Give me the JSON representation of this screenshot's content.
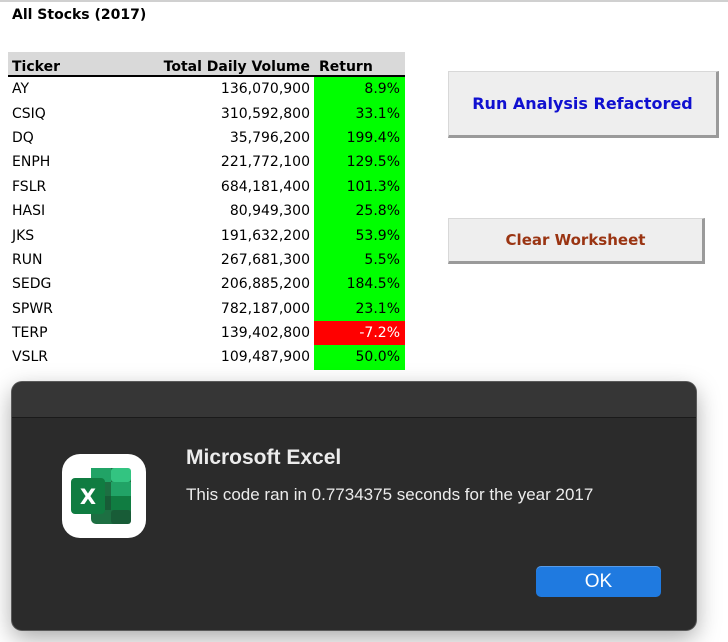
{
  "sheet": {
    "title": "All Stocks (2017)",
    "headers": {
      "ticker": "Ticker",
      "volume": "Total Daily Volume",
      "return": "Return"
    },
    "rows": [
      {
        "ticker": "AY",
        "volume": "136,070,900",
        "return": "8.9%",
        "status": "positive"
      },
      {
        "ticker": "CSIQ",
        "volume": "310,592,800",
        "return": "33.1%",
        "status": "positive"
      },
      {
        "ticker": "DQ",
        "volume": "35,796,200",
        "return": "199.4%",
        "status": "positive"
      },
      {
        "ticker": "ENPH",
        "volume": "221,772,100",
        "return": "129.5%",
        "status": "positive"
      },
      {
        "ticker": "FSLR",
        "volume": "684,181,400",
        "return": "101.3%",
        "status": "positive"
      },
      {
        "ticker": "HASI",
        "volume": "80,949,300",
        "return": "25.8%",
        "status": "positive"
      },
      {
        "ticker": "JKS",
        "volume": "191,632,200",
        "return": "53.9%",
        "status": "positive"
      },
      {
        "ticker": "RUN",
        "volume": "267,681,300",
        "return": "5.5%",
        "status": "positive"
      },
      {
        "ticker": "SEDG",
        "volume": "206,885,200",
        "return": "184.5%",
        "status": "positive"
      },
      {
        "ticker": "SPWR",
        "volume": "782,187,000",
        "return": "23.1%",
        "status": "positive"
      },
      {
        "ticker": "TERP",
        "volume": "139,402,800",
        "return": "-7.2%",
        "status": "negative"
      },
      {
        "ticker": "VSLR",
        "volume": "109,487,900",
        "return": "50.0%",
        "status": "positive"
      }
    ]
  },
  "buttons": {
    "run_label": "Run Analysis Refactored",
    "clear_label": "Clear Worksheet"
  },
  "dialog": {
    "app_name": "Microsoft Excel",
    "icon_letter": "X",
    "message": "This code ran in 0.7734375 seconds for the year 2017",
    "ok_label": "OK"
  },
  "colors": {
    "positive": "#00ff00",
    "negative": "#ff0000",
    "run_text": "#1010d0",
    "clear_text": "#9a3412",
    "excel_green": "#107c41",
    "ok_blue": "#1f7ae0"
  }
}
